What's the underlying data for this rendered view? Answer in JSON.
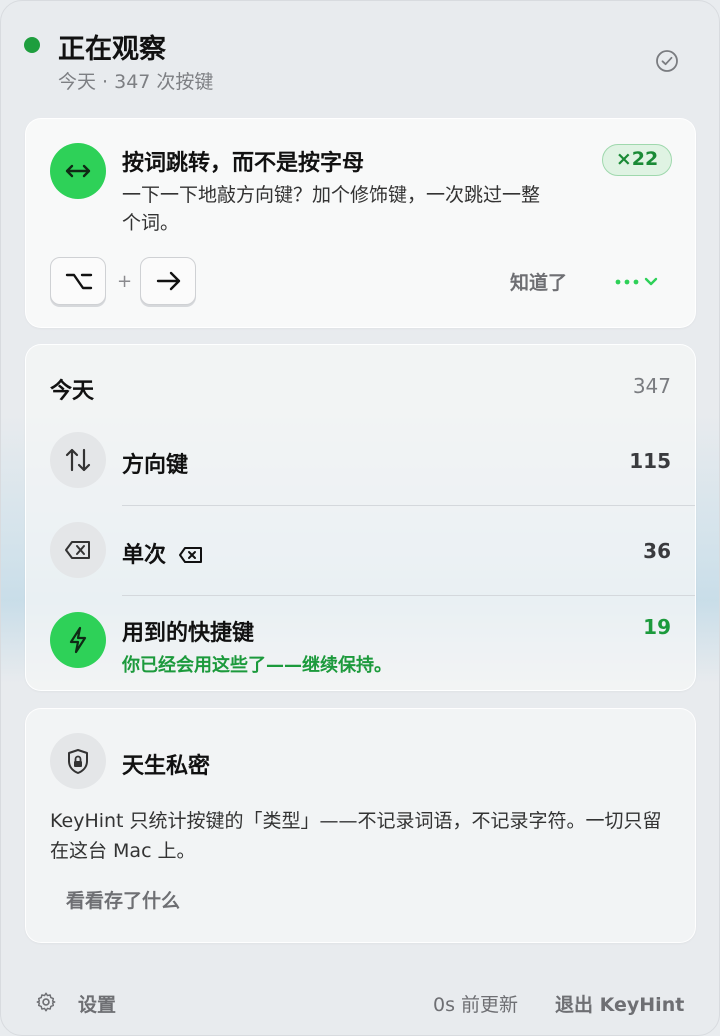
{
  "header": {
    "title": "正在观察",
    "subtitle": "今天 · 347 次按键",
    "status_color": "#1e9e3e"
  },
  "tip": {
    "icon": "arrow-left-right-icon",
    "title": "按词跳转，而不是按字母",
    "description": "一下一下地敲方向键？加个修饰键，一次跳过一整个词。",
    "count_badge": "×22",
    "keys": [
      "option-key-icon",
      "right-arrow-icon"
    ],
    "plus": "+",
    "dismiss_label": "知道了",
    "more_icon": "ellipsis-chevron-down-icon"
  },
  "today": {
    "label": "今天",
    "total": "347",
    "rows": [
      {
        "icon": "arrows-up-down-icon",
        "label": "方向键",
        "value": "115"
      },
      {
        "icon": "delete-key-icon",
        "label": "单次",
        "value": "36"
      },
      {
        "icon": "lightning-icon",
        "label": "用到的快捷键",
        "value": "19",
        "sub": "你已经会用这些了——继续保持。"
      }
    ]
  },
  "privacy": {
    "icon": "shield-lock-icon",
    "title": "天生私密",
    "description": "KeyHint 只统计按键的「类型」——不记录词语，不记录字符。一切只留在这台 Mac 上。",
    "link_label": "看看存了什么"
  },
  "footer": {
    "settings_label": "设置",
    "updated": "0s 前更新",
    "quit_label": "退出 KeyHint"
  },
  "colors": {
    "accent_green": "#2ed158",
    "text_green": "#1c9a3c"
  }
}
